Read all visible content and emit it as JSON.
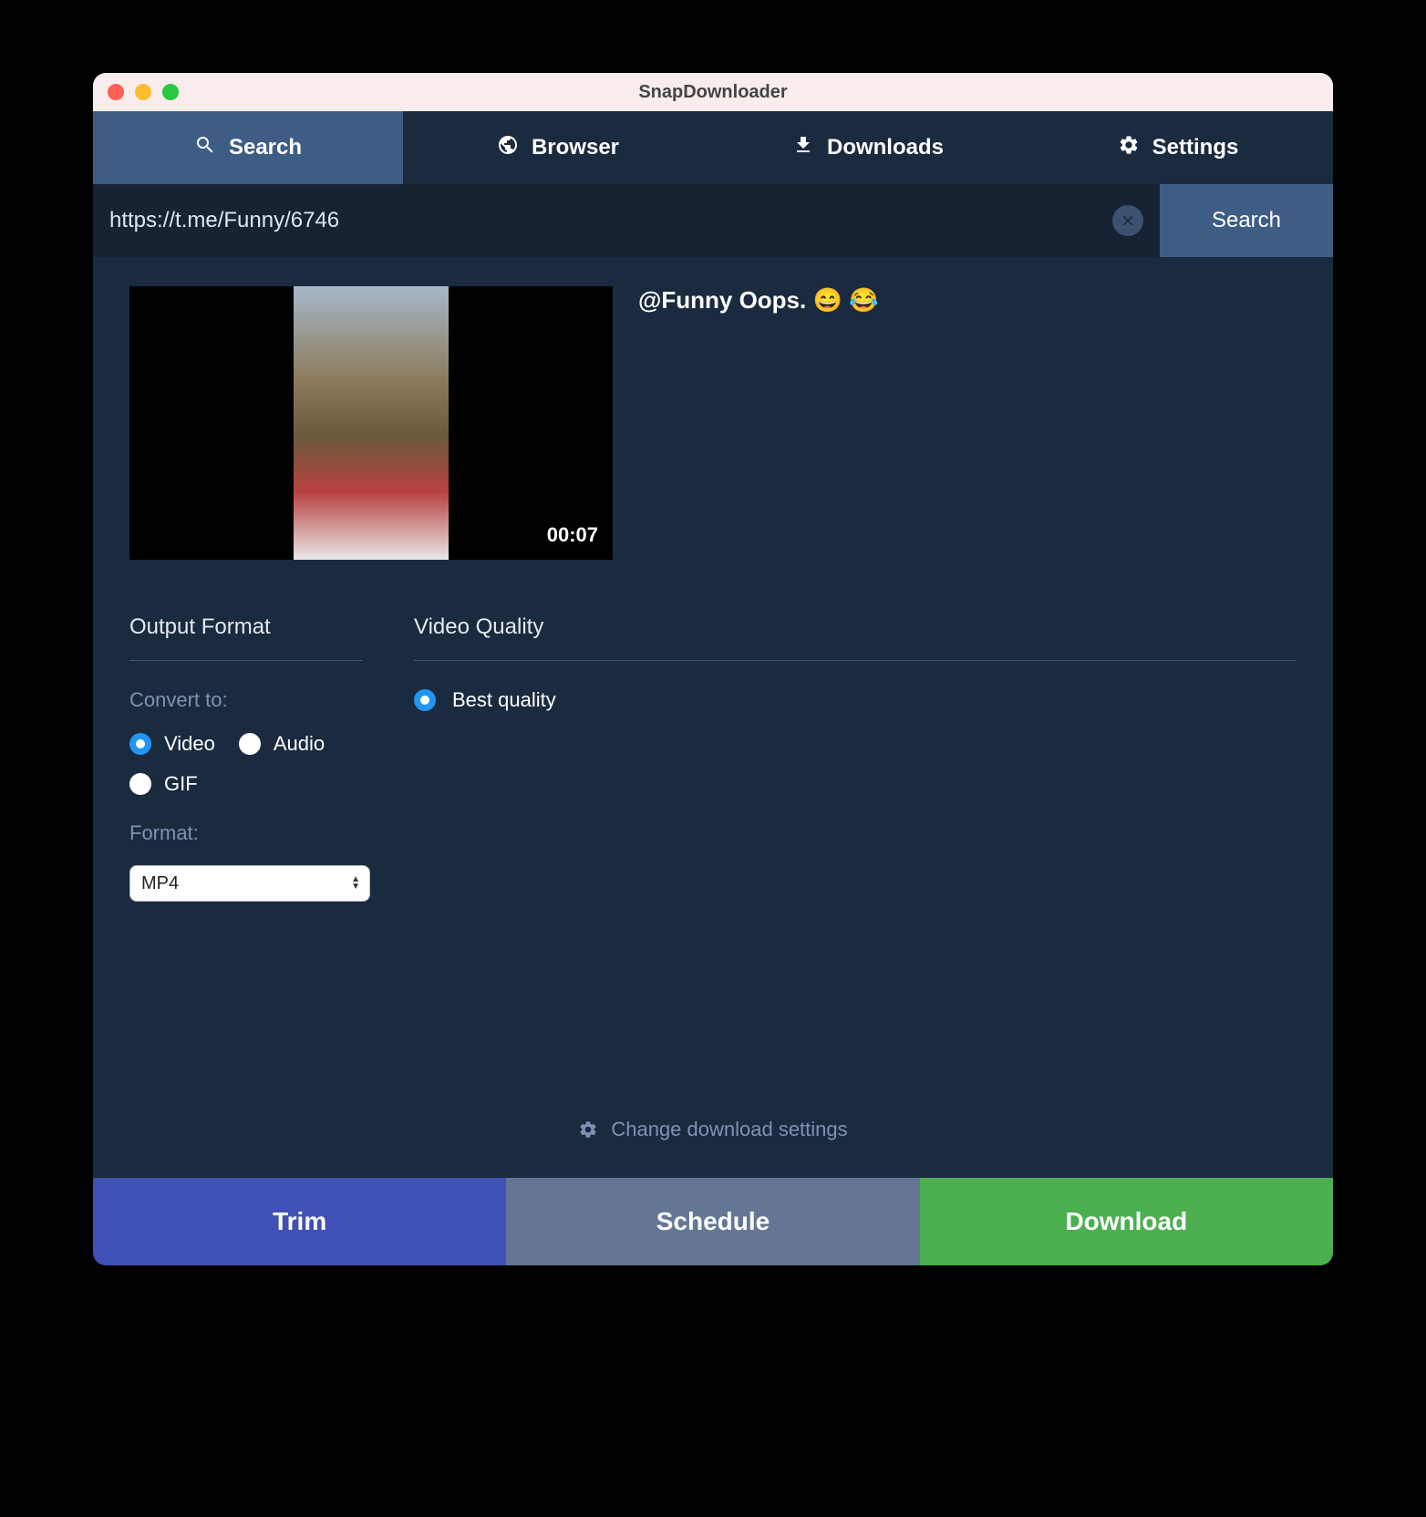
{
  "window_title": "SnapDownloader",
  "tabs": {
    "search": "Search",
    "browser": "Browser",
    "downloads": "Downloads",
    "settings": "Settings"
  },
  "search": {
    "value": "https://t.me/Funny/6746",
    "button": "Search"
  },
  "video": {
    "title": "@Funny Oops. 😄 😂",
    "duration": "00:07"
  },
  "output_format": {
    "header": "Output Format",
    "convert_label": "Convert to:",
    "options": {
      "video": "Video",
      "audio": "Audio",
      "gif": "GIF"
    },
    "format_label": "Format:",
    "format_value": "MP4"
  },
  "video_quality": {
    "header": "Video Quality",
    "option": "Best quality"
  },
  "change_settings": "Change download settings",
  "buttons": {
    "trim": "Trim",
    "schedule": "Schedule",
    "download": "Download"
  }
}
